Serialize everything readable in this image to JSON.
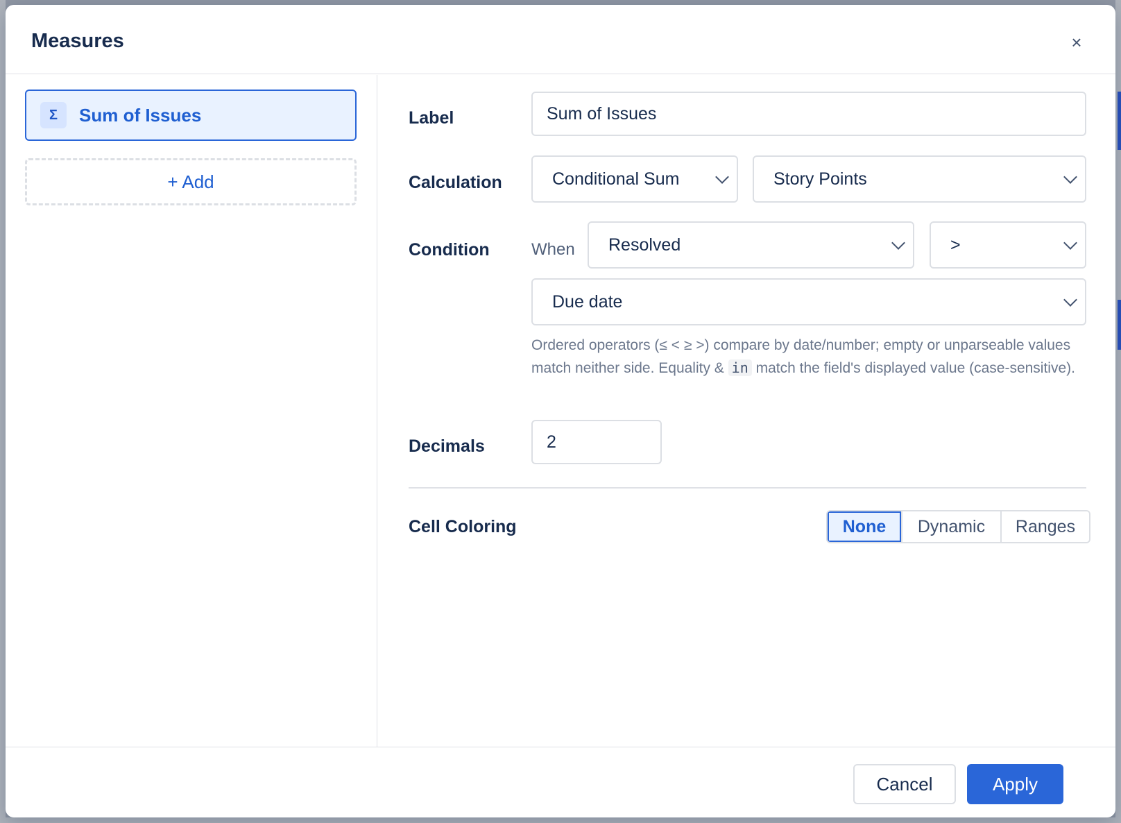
{
  "modal": {
    "title": "Measures",
    "close_symbol": "×"
  },
  "measures_list": {
    "items": [
      {
        "icon": "Σ",
        "label": "Sum of Issues",
        "selected": true
      }
    ],
    "add_label": "+ Add"
  },
  "form": {
    "label": {
      "title": "Label",
      "value": "Sum of Issues"
    },
    "calculation": {
      "title": "Calculation",
      "type_value": "Conditional Sum",
      "field_value": "Story Points"
    },
    "condition": {
      "title": "Condition",
      "when_text": "When",
      "field_value": "Resolved",
      "operator_value": ">",
      "compare_value": "Due date",
      "help_before": "Ordered operators (≤ < ≥ >) compare by date/number; empty or unparseable values match neither side. Equality & ",
      "help_code": "in",
      "help_after": " match the field's displayed value (case-sensitive)."
    },
    "decimals": {
      "title": "Decimals",
      "value": "2"
    },
    "cell_coloring": {
      "title": "Cell Coloring",
      "options": [
        "None",
        "Dynamic",
        "Ranges"
      ],
      "selected": "None"
    }
  },
  "footer": {
    "cancel_label": "Cancel",
    "apply_label": "Apply"
  },
  "colors": {
    "accent": "#2a66d8",
    "selected_bg": "#e9f2ff",
    "border": "#dcdfe4"
  }
}
